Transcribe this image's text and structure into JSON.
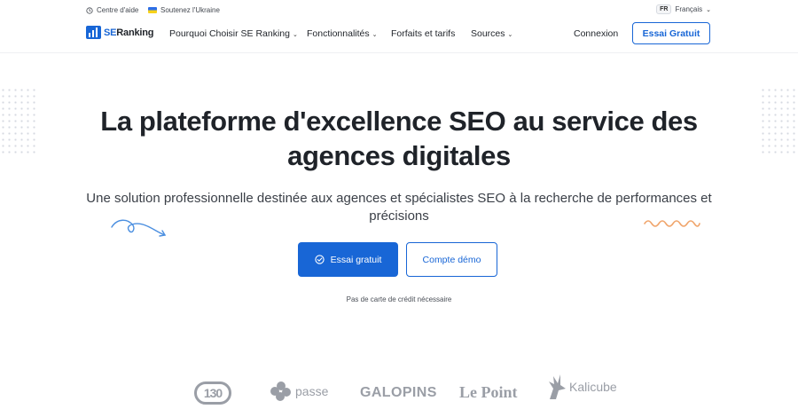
{
  "topbar": {
    "help_label": "Centre d'aide",
    "ukraine_label": "Soutenez l'Ukraine",
    "lang_code": "FR",
    "lang_label": "Français"
  },
  "nav": {
    "logo_se": "SE",
    "logo_ranking": "Ranking",
    "items": [
      {
        "label": "Pourquoi Choisir SE Ranking",
        "has_dropdown": true
      },
      {
        "label": "Fonctionnalités",
        "has_dropdown": true
      },
      {
        "label": "Forfaits et tarifs",
        "has_dropdown": false
      },
      {
        "label": "Sources",
        "has_dropdown": true
      }
    ],
    "login_label": "Connexion",
    "trial_label": "Essai Gratuit"
  },
  "hero": {
    "title": "La plateforme d'excellence SEO au service des agences digitales",
    "subtitle": "Une solution professionnelle destinée aux agences et spécialistes SEO à la recherche de performances et précisions",
    "primary_cta": "Essai gratuit",
    "secondary_cta": "Compte démo",
    "note": "Pas de carte de crédit nécessaire"
  },
  "client_logos": {
    "logo_130": "130",
    "passe": "passe",
    "galopins": "GALOPINS",
    "lepoint": "Le Point",
    "kalicube": "Kalicube"
  },
  "colors": {
    "brand_blue": "#1866d6",
    "swirl_blue": "#4b8fe0",
    "wave_orange": "#f0a46a",
    "logo_gray": "#9a9ea6"
  },
  "icons": {
    "help": "clock-icon",
    "ukraine": "ukraine-flag-icon",
    "dropdown": "chevron-down-icon",
    "cta": "check-circle-icon"
  }
}
